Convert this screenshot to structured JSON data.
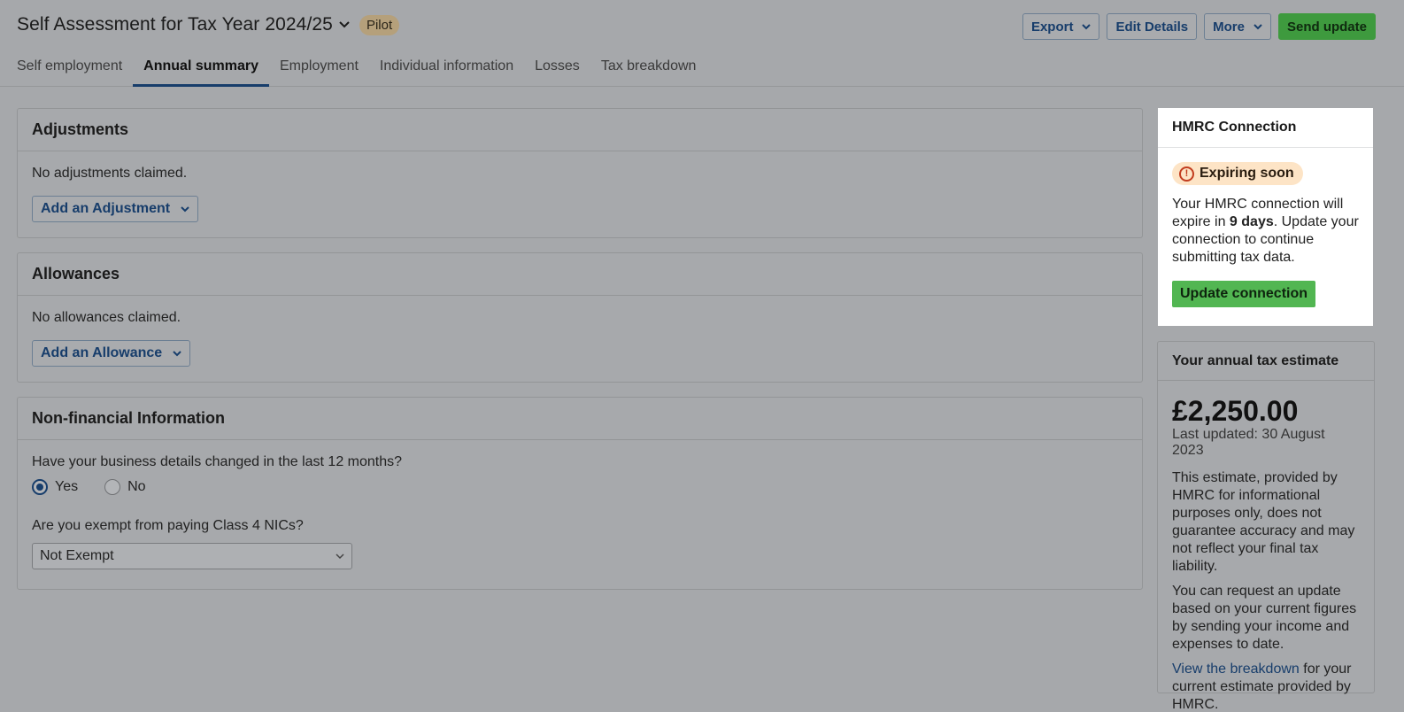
{
  "header": {
    "title": "Self Assessment for Tax Year 2024/25",
    "badge": "Pilot",
    "actions": {
      "export": "Export",
      "edit_details": "Edit Details",
      "more": "More",
      "send_update": "Send update"
    }
  },
  "tabs": [
    {
      "label": "Self employment",
      "active": false
    },
    {
      "label": "Annual summary",
      "active": true
    },
    {
      "label": "Employment",
      "active": false
    },
    {
      "label": "Individual information",
      "active": false
    },
    {
      "label": "Losses",
      "active": false
    },
    {
      "label": "Tax breakdown",
      "active": false
    }
  ],
  "adjustments": {
    "title": "Adjustments",
    "empty_text": "No adjustments claimed.",
    "add_label": "Add an Adjustment"
  },
  "allowances": {
    "title": "Allowances",
    "empty_text": "No allowances claimed.",
    "add_label": "Add an Allowance"
  },
  "non_financial": {
    "title": "Non-financial Information",
    "question1": "Have your business details changed in the last 12 months?",
    "yes_label": "Yes",
    "no_label": "No",
    "selected": "Yes",
    "question2": "Are you exempt from paying Class 4 NICs?",
    "exempt_value": "Not Exempt"
  },
  "hmrc_connection": {
    "title": "HMRC Connection",
    "status": "Expiring soon",
    "text_before": "Your HMRC connection will expire in ",
    "days": "9 days",
    "text_after": ". Update your connection to continue submitting tax data.",
    "button": "Update connection"
  },
  "estimate": {
    "title": "Your annual tax estimate",
    "amount": "£2,250.00",
    "updated": "Last updated: 30 August 2023",
    "para1": "This estimate, provided by HMRC for informational purposes only, does not guarantee accuracy and may not reflect your final tax liability.",
    "para2": "You can request an update based on your current figures by sending your income and expenses to date.",
    "link": "View the breakdown",
    "para3_after": " for your current estimate provided by HMRC."
  },
  "icons": {
    "title_dropdown": "chevron-down-icon",
    "warning": "exclamation-circle-icon",
    "select_arrow": "chevron-down-icon"
  },
  "colors": {
    "primary_blue": "#173d6b",
    "send_green": "#3e9a3e",
    "update_green": "#52b652",
    "expiring_bg": "#fde4c6",
    "warning_red": "#c23d1f"
  }
}
